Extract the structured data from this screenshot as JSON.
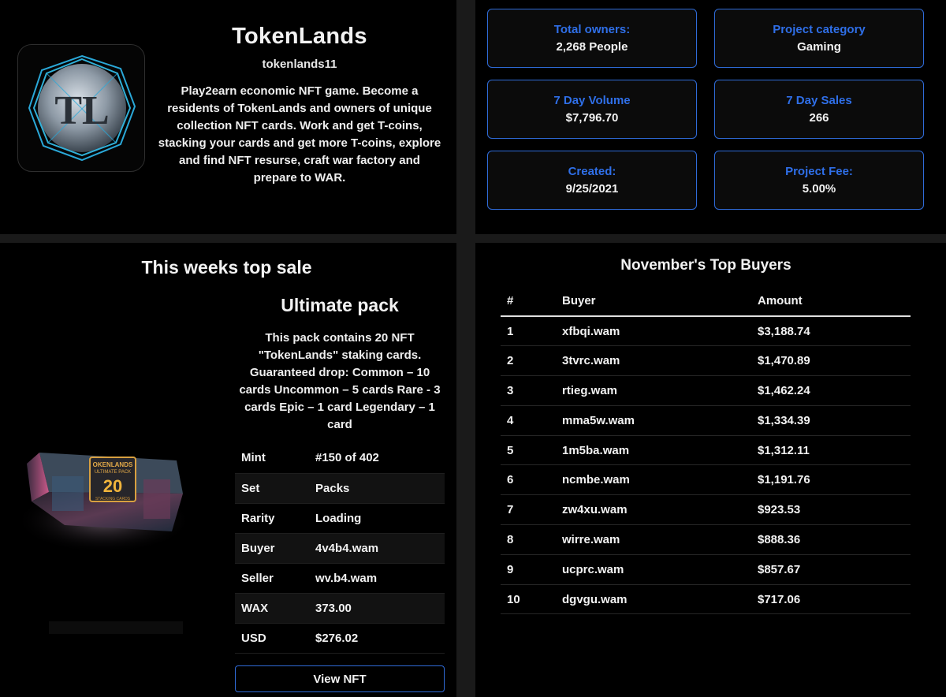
{
  "project": {
    "name": "TokenLands",
    "handle": "tokenlands11",
    "description": "Play2earn economic NFT game. Become a residents of TokenLands and owners of unique collection NFT cards. Work and get T-coins, stacking your cards and get more T-coins, explore and find NFT resurse, craft war factory and prepare to WAR.",
    "logo_text": "TL"
  },
  "stats": [
    {
      "label": "Total owners:",
      "value": "2,268 People"
    },
    {
      "label": "Project category",
      "value": "Gaming"
    },
    {
      "label": "7 Day Volume",
      "value": "$7,796.70"
    },
    {
      "label": "7 Day Sales",
      "value": "266"
    },
    {
      "label": "Created:",
      "value": "9/25/2021"
    },
    {
      "label": "Project Fee:",
      "value": "5.00%"
    }
  ],
  "top_sale": {
    "heading": "This weeks top sale",
    "pack_title": "Ultimate pack",
    "pack_description": "This pack contains 20 NFT \"TokenLands\" staking cards. Guaranteed drop: Common – 10 cards Uncommon – 5 cards Rare - 3 cards Epic – 1 card Legendary – 1 card",
    "pack_art": {
      "brand": "OKENLANDS",
      "subtitle": "ULTIMATE PACK",
      "number": "20",
      "footer": "STACKING CARDS"
    },
    "rows": [
      {
        "key": "Mint",
        "value": "#150 of 402"
      },
      {
        "key": "Set",
        "value": "Packs"
      },
      {
        "key": "Rarity",
        "value": "Loading"
      },
      {
        "key": "Buyer",
        "value": "4v4b4.wam"
      },
      {
        "key": "Seller",
        "value": "wv.b4.wam"
      },
      {
        "key": "WAX",
        "value": "373.00"
      },
      {
        "key": "USD",
        "value": "$276.02"
      }
    ],
    "button_label": "View NFT"
  },
  "buyers": {
    "heading": "November's Top Buyers",
    "columns": [
      "#",
      "Buyer",
      "Amount"
    ],
    "rows": [
      {
        "rank": "1",
        "buyer": "xfbqi.wam",
        "amount": "$3,188.74"
      },
      {
        "rank": "2",
        "buyer": "3tvrc.wam",
        "amount": "$1,470.89"
      },
      {
        "rank": "3",
        "buyer": "rtieg.wam",
        "amount": "$1,462.24"
      },
      {
        "rank": "4",
        "buyer": "mma5w.wam",
        "amount": "$1,334.39"
      },
      {
        "rank": "5",
        "buyer": "1m5ba.wam",
        "amount": "$1,312.11"
      },
      {
        "rank": "6",
        "buyer": "ncmbe.wam",
        "amount": "$1,191.76"
      },
      {
        "rank": "7",
        "buyer": "zw4xu.wam",
        "amount": "$923.53"
      },
      {
        "rank": "8",
        "buyer": "wirre.wam",
        "amount": "$888.36"
      },
      {
        "rank": "9",
        "buyer": "ucprc.wam",
        "amount": "$857.67"
      },
      {
        "rank": "10",
        "buyer": "dgvgu.wam",
        "amount": "$717.06"
      }
    ]
  },
  "colors": {
    "accent": "#2f6fe8",
    "panel_bg": "#000000",
    "page_bg": "#1a1a1a",
    "text": "#f2f2f2"
  }
}
